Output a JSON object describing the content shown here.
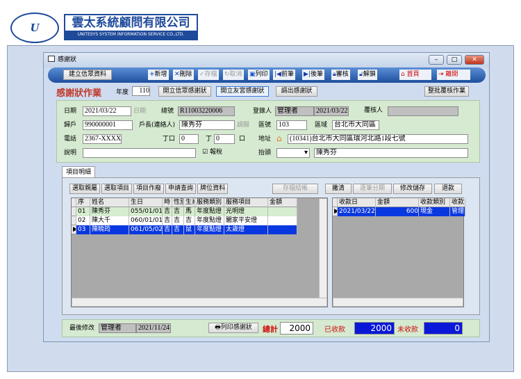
{
  "logo": {
    "mark": "Unitesys",
    "company_cn": "雲太系統顧問有限公司",
    "company_en": "UNITESYS SYSTEM INFORMATION SERVICE CO.,LTD."
  },
  "window": {
    "title": "感謝狀",
    "min": "–",
    "max": "□",
    "close": "✕"
  },
  "toolbar": {
    "create": "建立信眾資料",
    "add": "新增",
    "delete": "刪除",
    "save": "存檔",
    "cancel": "取消",
    "print": "列印",
    "prev": "前筆",
    "next": "後筆",
    "approve": "審核",
    "unlock": "解鎖",
    "home": "首頁",
    "exit": "離開"
  },
  "header": {
    "title": "感謝狀作業",
    "year_label": "年度",
    "year": "110",
    "btn1": "開立信眾感謝狀",
    "btn2": "開立友宮感謝狀",
    "btn3": "調出感謝狀",
    "btn4": "整批覆核作業"
  },
  "form": {
    "date_label": "日期",
    "date": "2021/03/22",
    "date_btn": "日期",
    "serial_label": "總號",
    "serial": "R11003220006",
    "registrar_label": "登錄人",
    "registrar": "管理者",
    "reg_date": "2021/03/22",
    "reviewer_label": "覆核人",
    "household_label": "歸戶",
    "household": "990000001",
    "head_label": "戶長(連絡人)",
    "head": "陳秀芬",
    "adjust": "調閱",
    "zip_label": "區號",
    "zip": "103",
    "district_label": "區域",
    "district": "台北市大同區",
    "phone_label": "電話",
    "phone": "2367-XXXX",
    "male_label": "丁口",
    "male": "0",
    "ding_label": "丁",
    "female": "0",
    "kou_label": "口",
    "address_label": "地址",
    "address": "(10341)台北市大同區環河北路1段七號",
    "note_label": "說明",
    "note": "",
    "tax_label": "報稅",
    "tax_checked": true,
    "heading_label": "抬頭",
    "heading_select": "",
    "heading": "陳秀芬"
  },
  "tab": "項目明細",
  "grid_buttons": [
    "選取親屬",
    "選取項目",
    "項目作廢",
    "申請查詢",
    "牌位資料"
  ],
  "right_buttons": {
    "save_close": "存檔結帳",
    "clear": "撇清",
    "split": "逐筆分期",
    "modify_save": "修改儲存",
    "refund": "退款"
  },
  "items": {
    "columns": [
      "序",
      "姓名",
      "生日",
      "時",
      "性別",
      "生肖",
      "服務類別",
      "服務項目",
      "金額"
    ],
    "rows": [
      [
        "01",
        "陳秀芬",
        "055/01/01",
        "吉",
        "吉",
        "馬",
        "年度點燈",
        "光明燈",
        ""
      ],
      [
        "02",
        "陳大千",
        "060/01/01",
        "吉",
        "吉",
        "吉",
        "年度點燈",
        "闔家平安燈",
        ""
      ],
      [
        "03",
        "陳曉筠",
        "061/05/02",
        "吉",
        "吉",
        "鼠",
        "年度點燈",
        "太歲燈",
        ""
      ]
    ],
    "selected": 2
  },
  "payments": {
    "columns": [
      "收款日",
      "金額",
      "收款類別",
      "收款"
    ],
    "rows": [
      [
        "2021/03/22",
        "600",
        "現金",
        "管理"
      ]
    ]
  },
  "footer": {
    "modified_label": "最後修改",
    "modified_by": "管理者",
    "modified_date": "2021/11/24",
    "print": "列印感謝狀",
    "total_label": "總計",
    "total": "2000",
    "received_label": "已收款",
    "received": "2000",
    "unpaid_label": "未收款",
    "unpaid": "0"
  }
}
